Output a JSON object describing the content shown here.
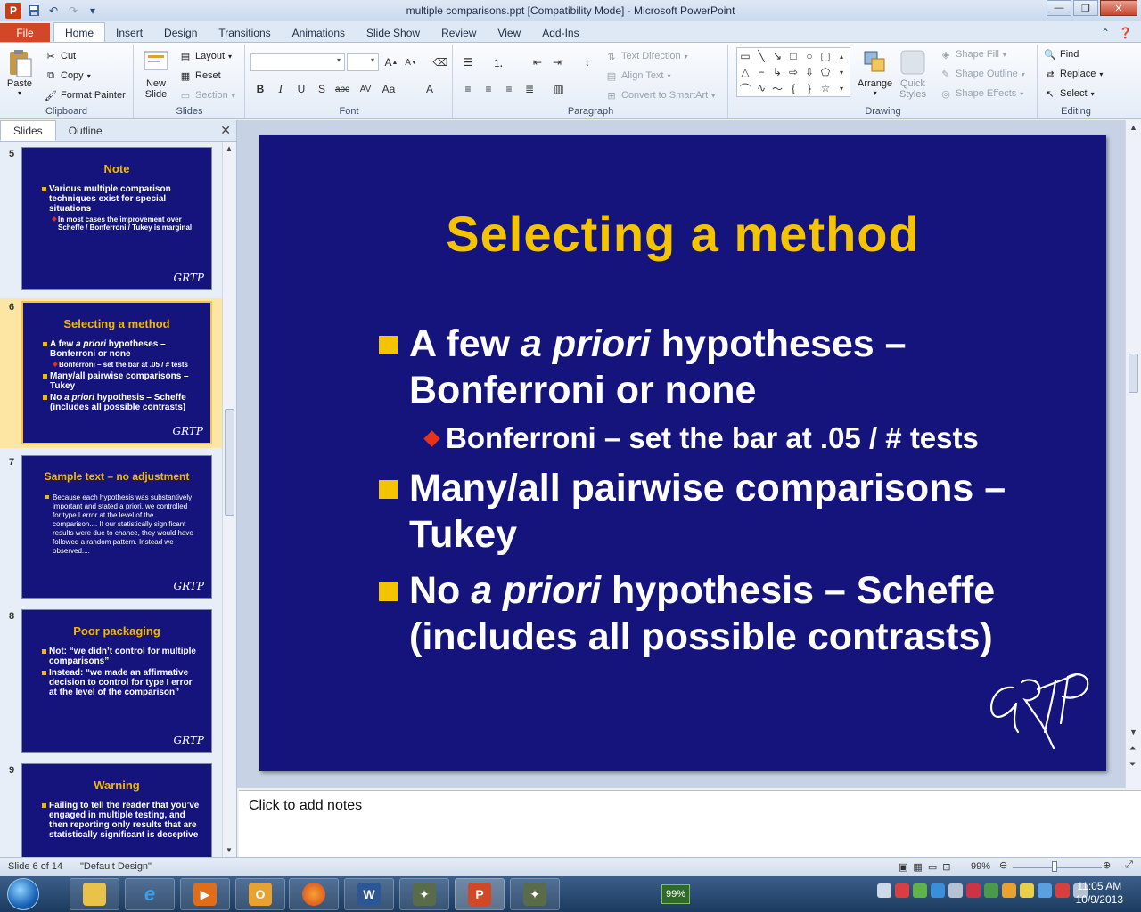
{
  "window": {
    "title": "multiple comparisons.ppt [Compatibility Mode]  -  Microsoft PowerPoint"
  },
  "ribbon": {
    "tabs": [
      "File",
      "Home",
      "Insert",
      "Design",
      "Transitions",
      "Animations",
      "Slide Show",
      "Review",
      "View",
      "Add-Ins"
    ],
    "clipboard": {
      "paste": "Paste",
      "cut": "Cut",
      "copy": "Copy",
      "format_painter": "Format Painter",
      "label": "Clipboard"
    },
    "slides": {
      "new_slide": "New\nSlide",
      "new_slide_l1": "New",
      "new_slide_l2": "Slide",
      "layout": "Layout",
      "reset": "Reset",
      "section": "Section",
      "label": "Slides"
    },
    "font": {
      "label": "Font"
    },
    "paragraph": {
      "text_direction": "Text Direction",
      "align_text": "Align Text",
      "convert_smartart": "Convert to SmartArt",
      "label": "Paragraph"
    },
    "drawing": {
      "arrange": "Arrange",
      "quick_styles_l1": "Quick",
      "quick_styles_l2": "Styles",
      "shape_fill": "Shape Fill",
      "shape_outline": "Shape Outline",
      "shape_effects": "Shape Effects",
      "label": "Drawing"
    },
    "editing": {
      "find": "Find",
      "replace": "Replace",
      "select": "Select",
      "label": "Editing"
    }
  },
  "left_panel": {
    "tabs": [
      "Slides",
      "Outline"
    ],
    "thumbnails": [
      {
        "num": "5",
        "title": "Note",
        "bullets": [
          "Various multiple comparison techniques exist for special situations"
        ],
        "subs": [
          "In most cases  the improvement over Scheffe  / Bonferroni / Tukey  is marginal"
        ]
      },
      {
        "num": "6",
        "title": "Selecting a method",
        "b1": "A few a priori hypotheses – Bonferroni or none",
        "b1_pre": "A few ",
        "b1_em": "a priori",
        "b1_post": " hypotheses – Bonferroni or none",
        "s1": "Bonferroni – set the bar at .05 / # tests",
        "b2": "Many/all pairwise comparisons – Tukey",
        "b3_pre": "No ",
        "b3_em": "a priori",
        "b3_post": " hypothesis – Scheffe (includes all possible contrasts)"
      },
      {
        "num": "7",
        "title": "Sample text – no adjustment",
        "para": "Because  each  hypothesis  was  substantively  important  and stated  a  priori,  we  controlled  for type  I error at the level of the comparison....  If  our  statistically  significant  results  were  due  to  chance,  they  would  have followed  a  random pattern.  Instead we observed...."
      },
      {
        "num": "8",
        "title": "Poor packaging",
        "bullets": [
          "Not: “we didn’t control for multiple comparisons”",
          "Instead: “we made an affirmative decision to control for type I error at the level of the comparison”"
        ]
      },
      {
        "num": "9",
        "title": "Warning",
        "bullets": [
          "Failing to tell the reader that you’ve engaged in multiple testing, and then reporting only results that are statistically significant is deceptive"
        ]
      }
    ],
    "signature": "GRTP"
  },
  "slide": {
    "title": "Selecting a method",
    "bullet1_pre": "A few ",
    "bullet1_em": "a priori",
    "bullet1_post": " hypotheses –",
    "bullet1_line2": "Bonferroni or none",
    "sub1": "Bonferroni – set the bar at .05 / # tests",
    "bullet2_line1": "Many/all pairwise comparisons –",
    "bullet2_line2": "Tukey",
    "bullet3_pre": "No ",
    "bullet3_em": "a priori",
    "bullet3_post": " hypothesis – Scheffe",
    "bullet3_line2": "(includes all possible contrasts)"
  },
  "notes": {
    "placeholder": "Click to add notes"
  },
  "status": {
    "slide_info": "Slide 6 of 14",
    "theme": "\"Default Design\"",
    "zoom": "99%"
  },
  "taskbar": {
    "battery": "99%",
    "time": "11:05 AM",
    "date": "10/9/2013"
  },
  "colors": {
    "slide_bg": "#14147c",
    "title_yellow": "#f5c400",
    "bullet_square": "#f5c400",
    "sub_diamond": "#e8321a",
    "file_tab": "#d24726"
  }
}
